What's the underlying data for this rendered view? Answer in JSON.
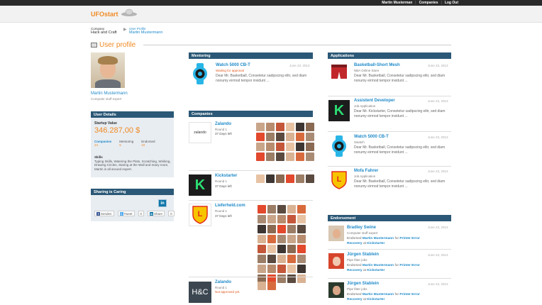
{
  "topnav": {
    "user": "Martin Musterman",
    "companies": "Companies",
    "logout": "Log Out"
  },
  "logo": "UFOstart",
  "breadcrumb": {
    "company_small": "Company",
    "company_big": "Hack and Craft",
    "profile_small": "User Profile",
    "profile_big": "Martin Mustermann"
  },
  "page_title": "User profile",
  "user": {
    "name": "Martin Mustermann",
    "title": "Computer stuff expert"
  },
  "user_details": {
    "heading": "User Details",
    "startup_label": "Startup Value",
    "startup_value": "346.287,00 $",
    "stats": [
      {
        "label": "Companies",
        "value": "24"
      },
      {
        "label": "Mentoring",
        "value": "5"
      },
      {
        "label": "Endorsed",
        "value": "10"
      }
    ],
    "skills_heading": "Skills",
    "skills": "Typing Skills, Watering the Plats, Scratching, Winking, Drawing Circles, Staring at the Wall and many more, Martin is all around expert."
  },
  "sharing": {
    "heading": "Sharing is Caring",
    "linkedin_big": "in",
    "facebook": "Senden",
    "tweet": "Tweet",
    "tweet_count": "0",
    "share": "Share",
    "share_count": "0"
  },
  "mentoring": {
    "heading": "Mentoring",
    "item": {
      "title": "Watch 5000 CB-T",
      "status": "Waiting for approval",
      "date": "June 23, 2013",
      "text": "Dear Mr. Basketball, Consetetur sadipscing elitr, sed diam nonumy eirmod tempor invidunt ..."
    }
  },
  "companies": {
    "heading": "Companies",
    "items": [
      {
        "name": "Zalando",
        "round": "Round 1",
        "left": "37 Days left",
        "logo": "zalando"
      },
      {
        "name": "Kickstarter",
        "round": "Round 1",
        "left": "37 Days left",
        "logo": "K"
      },
      {
        "name": "Lieferheld.com",
        "round": "Round 1",
        "left": "37 Days left",
        "logo": "LIEFERHELD"
      },
      {
        "name": "Zalando",
        "round": "Round 1",
        "left": "Not approved yet.",
        "logo": "H&C"
      }
    ]
  },
  "applications": {
    "heading": "Applications",
    "items": [
      {
        "title": "Basketball-Short Mesh",
        "sub": "NBA Online Store",
        "date": "June 23, 2013",
        "text": "Dear Mr. Basketball, Consetetur sadipscing elitr, sed diam nonumy eirmod tempor invidunt ..."
      },
      {
        "title": "Assistent Developer",
        "sub": "Job Application",
        "date": "June 23, 2013",
        "text": "Dear Mr. Kickstarter, Consetetur sadipscing elitr, sed diam nonumy eirmod tempor invidunt ..."
      },
      {
        "title": "Watch 5000 CB-T",
        "sub": "Swatch",
        "date": "June 23, 2013",
        "text": "Dear Mr. Basketball, Consetetur sadipscing elitr, sed diam nonumy eirmod tempor invidunt ..."
      },
      {
        "title": "Mofa Fahrer",
        "sub": "Job Application",
        "date": "June 23, 2013",
        "text": "Dear Mr. Basketball, Consetetur sadipscing elitr, sed diam nonumy eirmod tempor invidunt ..."
      }
    ]
  },
  "endorsement": {
    "heading": "Endorsement",
    "items": [
      {
        "name": "Bradley Swine",
        "sub": "Computer stuff expert",
        "date": "June 23, 2013",
        "e1": "Endorsed ",
        "e2": "Martin Mustermann",
        "e3": " for ",
        "e4": "Printer Error",
        "e5": "Recovery",
        "e6": " at ",
        "e7": "Kickstarter"
      },
      {
        "name": "Jürgen Stablein",
        "sub": "Pipe fitter jobs",
        "date": "June 23, 2013",
        "e1": "Endorsed ",
        "e2": "Martin Mustermann",
        "e3": " for ",
        "e4": "Printer Error",
        "e5": "Recovery",
        "e6": " at ",
        "e7": "Kickstarter"
      },
      {
        "name": "Jürgen Stablein",
        "sub": "Pipe fitter jobs",
        "date": "June 23, 2013",
        "e1": "Endorsed ",
        "e2": "Martin Mustermann",
        "e3": " for ",
        "e4": "Printer Error",
        "e5": "Recovery",
        "e6": " at ",
        "e7": "Kickstarter"
      }
    ]
  },
  "colors": {
    "accent": "#f08a24",
    "link": "#1f8ac9",
    "panel_head": "#2b5876"
  }
}
